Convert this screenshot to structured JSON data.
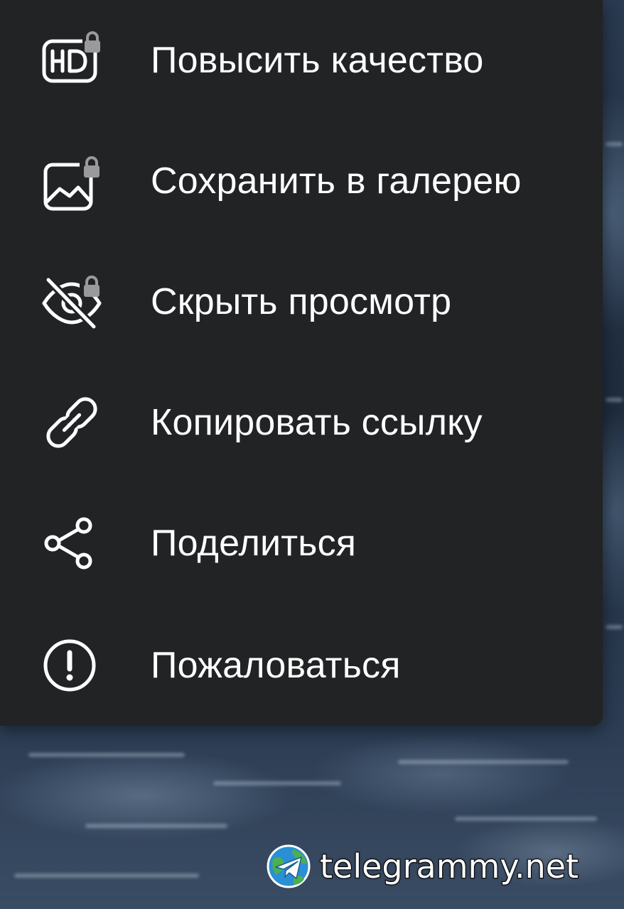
{
  "menu": {
    "items": [
      {
        "label": "Повысить качество",
        "icon": "hd-icon",
        "locked": true
      },
      {
        "label": "Сохранить в галерею",
        "icon": "gallery-image-icon",
        "locked": true
      },
      {
        "label": "Скрыть просмотр",
        "icon": "eye-off-icon",
        "locked": true
      },
      {
        "label": "Копировать ссылку",
        "icon": "link-icon",
        "locked": false
      },
      {
        "label": "Поделиться",
        "icon": "share-icon",
        "locked": false
      },
      {
        "label": "Пожаловаться",
        "icon": "report-icon",
        "locked": false
      }
    ],
    "background_color": "#222325",
    "text_color": "#ffffff",
    "lock_color": "#9a9a9c"
  },
  "watermark": {
    "text": "telegrammy.net",
    "logo_icon": "telegram-globe-icon"
  }
}
